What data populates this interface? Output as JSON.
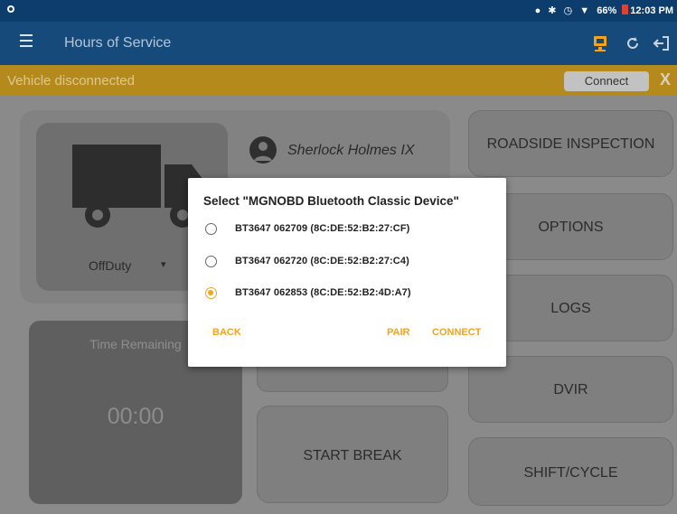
{
  "status_bar": {
    "time": "12:03 PM",
    "battery": "66%",
    "icons": [
      "app-notification-icon",
      "location-icon",
      "bluetooth-icon",
      "alarm-icon",
      "wifi-icon",
      "battery-icon"
    ]
  },
  "app_bar": {
    "title": "Hours of Service",
    "actions": [
      "connection-status-icon",
      "refresh-icon",
      "logout-icon"
    ]
  },
  "warning_bar": {
    "text": "Vehicle disconnected",
    "connect_label": "Connect",
    "close_label": "X"
  },
  "driver": {
    "name": "Sherlock Holmes IX",
    "status": "OffDuty"
  },
  "time_remaining": {
    "label": "Time Remaining",
    "value": "00:00"
  },
  "main_buttons": {
    "start_break": "START BREAK"
  },
  "side_buttons": [
    {
      "label": "ROADSIDE INSPECTION"
    },
    {
      "label": "OPTIONS"
    },
    {
      "label": "LOGS"
    },
    {
      "label": "DVIR"
    },
    {
      "label": "SHIFT/CYCLE"
    }
  ],
  "dialog": {
    "title": "Select \"MGNOBD Bluetooth Classic Device\"",
    "options": [
      {
        "label": "BT3647 062709 (8C:DE:52:B2:27:CF)",
        "selected": false
      },
      {
        "label": "BT3647 062720 (8C:DE:52:B2:27:C4)",
        "selected": false
      },
      {
        "label": "BT3647 062853 (8C:DE:52:B2:4D:A7)",
        "selected": true
      }
    ],
    "back_label": "BACK",
    "pair_label": "PAIR",
    "connect_label": "CONNECT"
  },
  "colors": {
    "status_bar": "#0d3d6d",
    "app_bar": "#164a7b",
    "warning_bar": "#b58a1c",
    "accent": "#f3a31c",
    "overlay_bg": "#8a8a8a"
  }
}
